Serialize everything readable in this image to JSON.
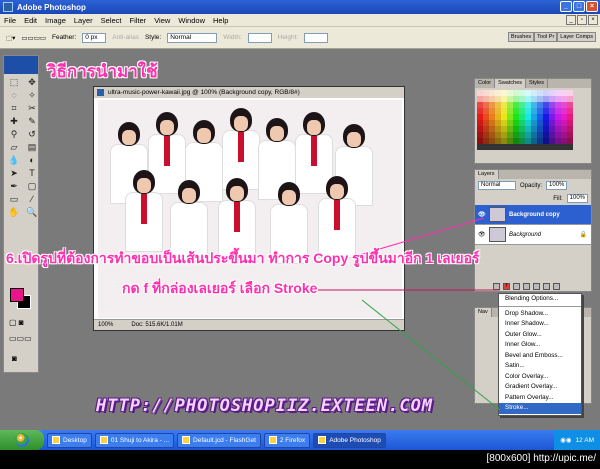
{
  "window": {
    "title": "Adobe Photoshop"
  },
  "menu": [
    "File",
    "Edit",
    "Image",
    "Layer",
    "Select",
    "Filter",
    "View",
    "Window",
    "Help"
  ],
  "options": {
    "feather_label": "Feather:",
    "feather_value": "0 px",
    "antialias": "Anti-alias",
    "style_label": "Style:",
    "style_value": "Normal",
    "width_label": "Width:",
    "height_label": "Height:",
    "tabs": [
      "Brushes",
      "Tool Pr",
      "Layer Comps"
    ]
  },
  "headline": "วิธีการนำมาใช้",
  "document": {
    "title": "ultra-music-power-kawaii.jpg @ 100% (Background copy, RGB/8#)",
    "zoom": "100%",
    "doc_size": "Doc: 515.6K/1.01M"
  },
  "color_palette": {
    "tabs": [
      "Color",
      "Swatches",
      "Styles"
    ],
    "active_tab": "Swatches"
  },
  "layers_palette": {
    "tab": "Layers",
    "blend_mode": "Normal",
    "opacity_label": "Opacity:",
    "opacity_value": "100%",
    "fill_label": "Fill:",
    "fill_value": "100%",
    "layers": [
      {
        "name": "Background copy",
        "active": true
      },
      {
        "name": "Background",
        "active": false
      }
    ]
  },
  "navigator": {
    "tab": "Nav"
  },
  "layer_style_menu": {
    "items": [
      "Blending Options...",
      "Drop Shadow...",
      "Inner Shadow...",
      "Outer Glow...",
      "Inner Glow...",
      "Bevel and Emboss...",
      "Satin...",
      "Color Overlay...",
      "Gradient Overlay...",
      "Pattern Overlay...",
      "Stroke..."
    ],
    "selected": "Stroke..."
  },
  "overlay": {
    "step_text": "6.เปิดรูปที่ต้องการทำขอบเป็นเส้นประขึ้นมา ทำการ Copy รูปขึ้นมาอีก 1 เลเยอร์",
    "step_text_2": "กด f ที่กล่องเลเยอร์ เลือก Stroke",
    "url": "HTTP://PHOTOSHOPIIZ.EXTEEN.COM"
  },
  "taskbar": {
    "items": [
      "Desktop",
      "01 Shuji to Akira - ...",
      "Default.jcd - FlashGet",
      "2 Firefox",
      "Adobe Photoshop"
    ],
    "active": "Adobe Photoshop",
    "clock": "12 AM"
  },
  "footer": {
    "resolution": "[800x600] http://upic.me/"
  },
  "colors": {
    "accent_pink": "#ff2fb0",
    "selection_blue": "#316ac5",
    "foreground": "#e8158a",
    "background": "#000000"
  }
}
